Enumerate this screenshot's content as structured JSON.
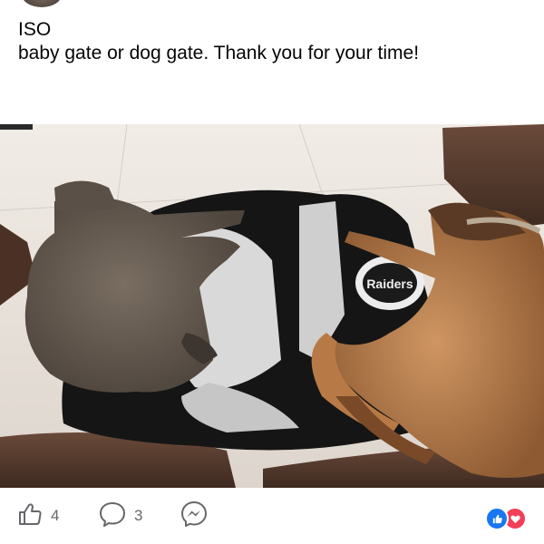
{
  "post": {
    "title_line": "ISO",
    "body_line": "baby gate or dog gate. Thank you for your time!"
  },
  "photo": {
    "blanket_text": "Raiders"
  },
  "actions": {
    "like_count": "4",
    "comment_count": "3"
  },
  "icons": {
    "like": "thumbs-up-icon",
    "comment": "comment-bubble-icon",
    "share": "messenger-icon",
    "reaction_like": "like-reaction-icon",
    "reaction_love": "love-reaction-icon"
  },
  "colors": {
    "text": "#050505",
    "muted": "#65676b",
    "like_blue": "#1877f2",
    "love_red": "#f33e58"
  }
}
